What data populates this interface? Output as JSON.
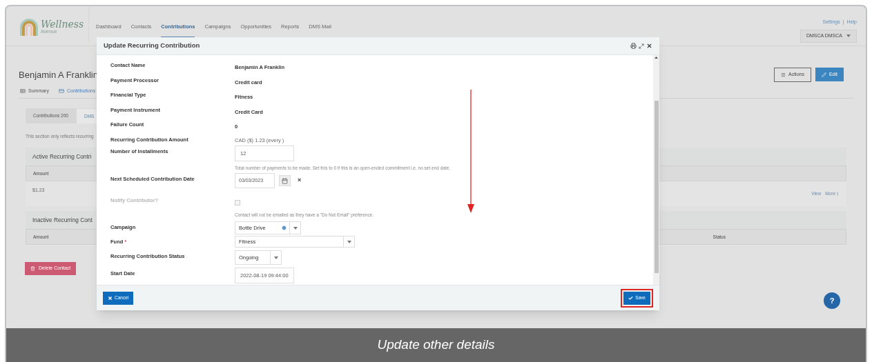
{
  "header": {
    "logo": {
      "name": "Wellness",
      "tagline": "Avenue"
    },
    "nav": [
      {
        "label": "Dashboard",
        "selected": false
      },
      {
        "label": "Contacts",
        "selected": false
      },
      {
        "label": "Contributions",
        "selected": true
      },
      {
        "label": "Campaigns",
        "selected": false
      },
      {
        "label": "Opportunities",
        "selected": false
      },
      {
        "label": "Reports",
        "selected": false
      },
      {
        "label": "DMS Mail",
        "selected": false
      }
    ],
    "top_links": [
      "Settings",
      "Help"
    ],
    "link_separator": "|",
    "user_menu": "DMSCA DMSCA"
  },
  "contact": {
    "name": "Benjamin A Franklin",
    "actions": [
      {
        "label": "Actions",
        "kind": "outline"
      },
      {
        "label": "Edit",
        "kind": "primary"
      }
    ],
    "tabs": [
      {
        "label": "Summary",
        "kind": "summary",
        "selected": false
      },
      {
        "label": "Contributions",
        "kind": "contributions",
        "selected": true
      }
    ],
    "subtabs": [
      {
        "label": "Contributions 200",
        "selected": false
      },
      {
        "label": "DMS",
        "selected": true
      }
    ],
    "note": "This section only reflects recurring",
    "active_panel": {
      "title": "Active Recurring Contri",
      "columns": [
        "Amount"
      ],
      "rows": [
        {
          "amount": "$1.23",
          "links": [
            "View",
            "More"
          ]
        }
      ]
    },
    "inactive_panel": {
      "title": "Inactive Recurring Cont",
      "columns": [
        "Amount",
        "Status"
      ]
    },
    "delete_button": "Delete Contact",
    "help_button": "?"
  },
  "modal": {
    "title": "Update Recurring Contribution",
    "fields": [
      {
        "kind": "text",
        "label": "Contact Name",
        "value": "Benjamin A Franklin"
      },
      {
        "kind": "text",
        "label": "Payment Processor",
        "value": "Credit card"
      },
      {
        "kind": "text",
        "label": "Financial Type",
        "value": "Fitness"
      },
      {
        "kind": "text",
        "label": "Payment Instrument",
        "value": "Credit Card"
      },
      {
        "kind": "text",
        "label": "Failure Count",
        "value": "0"
      },
      {
        "kind": "amount",
        "label": "Recurring Contribution Amount",
        "value": "CAD ($) 1.23 (every )"
      },
      {
        "kind": "input",
        "label": "Number of Installments",
        "value": "12",
        "hint": "Total number of payments to be made. Set this to 0 if this is an open-ended commitment i.e. no set end date."
      },
      {
        "kind": "date",
        "label": "Next Scheduled Contribution Date",
        "value": "03/03/2023",
        "clear": "×"
      },
      {
        "kind": "checkbox",
        "label": "Notify Contributor?",
        "disabled": true,
        "checked": false,
        "hint": "Contact will not be emailed as they have a \"Do Not Email\" preference."
      },
      {
        "kind": "combobox",
        "label": "Campaign",
        "value": "Bottle Drive"
      },
      {
        "kind": "select",
        "label": "Fund",
        "value": "Fitness",
        "required_mark": "*"
      },
      {
        "kind": "dropdown",
        "label": "Recurring Contribution Status",
        "value": "Ongoing"
      },
      {
        "kind": "input",
        "label": "Start Date",
        "value": "2022-08-19 09:44:00"
      }
    ],
    "buttons": [
      {
        "label": "Cancel",
        "kind": "cancel"
      },
      {
        "label": "Save",
        "kind": "save",
        "highlighted": true
      }
    ]
  },
  "caption": "Update other details"
}
